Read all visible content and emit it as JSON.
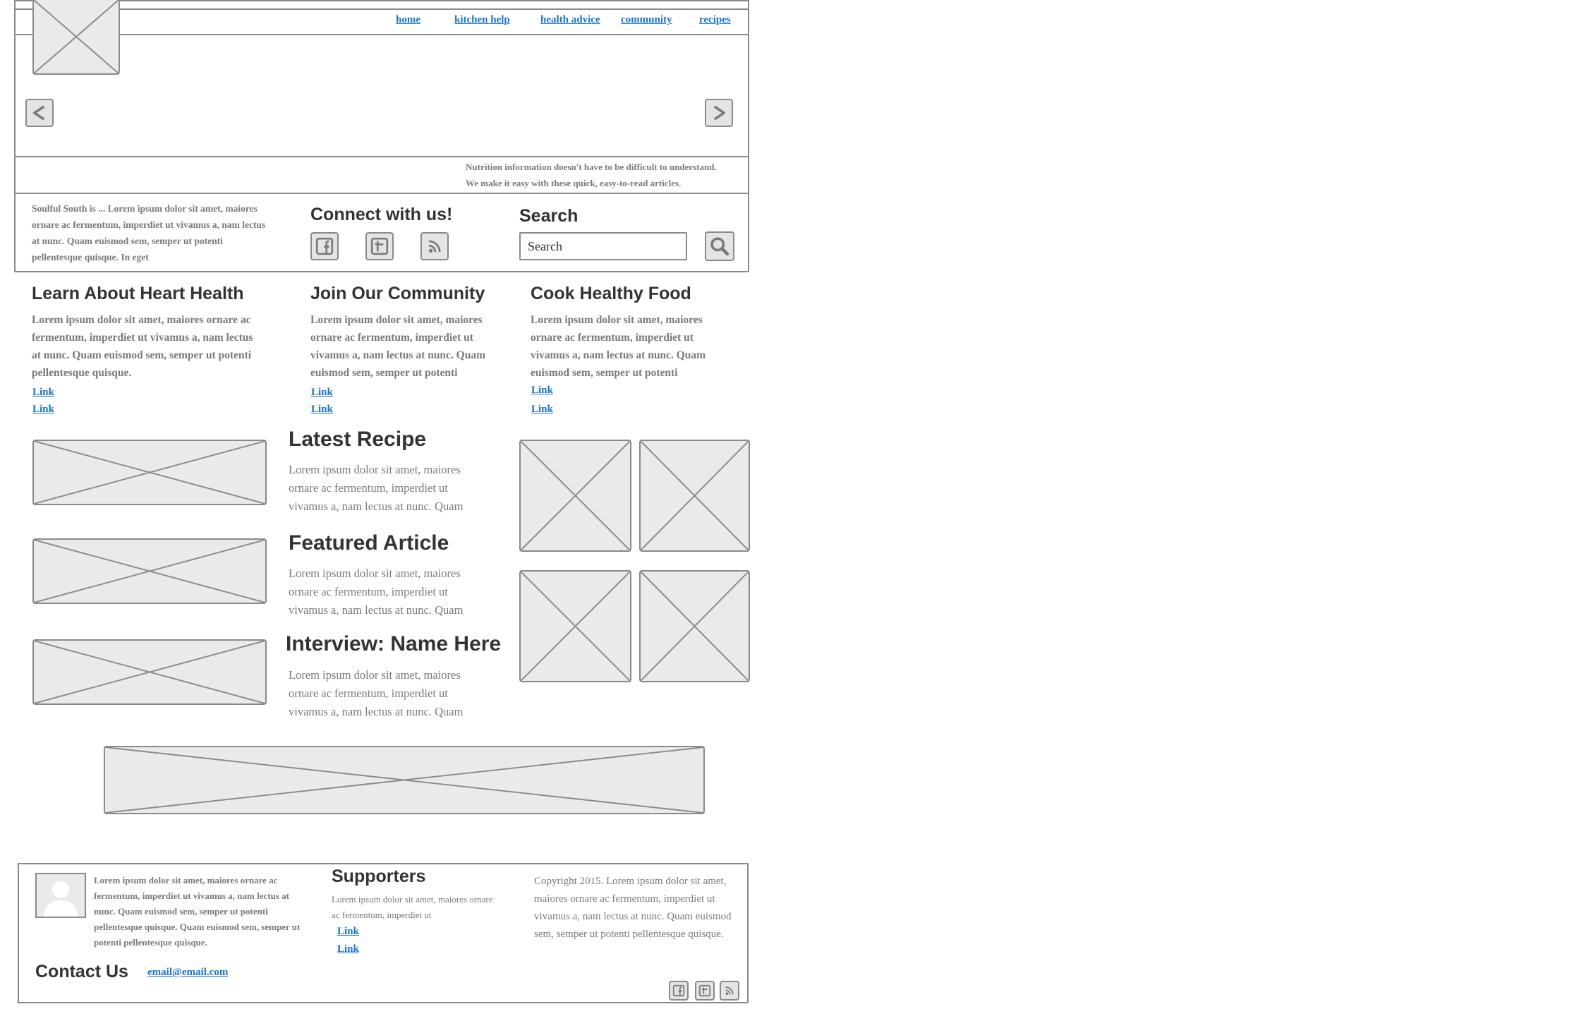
{
  "nav": {
    "items": [
      "home",
      "kitchen help",
      "health advice",
      "community",
      "recipes"
    ]
  },
  "hero": {
    "prev_label": "<",
    "next_label": ">",
    "tagline_1": "Nutrition information doesn't have to be difficult to understand.",
    "tagline_2": "We make it easy with these quick, easy-to-read articles."
  },
  "intro": {
    "text": "Soulful South is ... Lorem ipsum dolor sit amet, maiores ornare ac fermentum, imperdiet ut vivamus a, nam lectus at nunc. Quam euismod sem, semper ut potenti pellentesque quisque. In eget"
  },
  "connect": {
    "title": "Connect with us!",
    "icons": [
      "facebook-icon",
      "twitter-icon",
      "rss-icon"
    ]
  },
  "search": {
    "title": "Search",
    "value": "Search"
  },
  "features": [
    {
      "title": "Learn About Heart Health",
      "text": "Lorem ipsum dolor sit amet, maiores ornare ac fermentum, imperdiet ut vivamus a, nam lectus at nunc. Quam euismod sem, semper ut potenti pellentesque quisque.",
      "links": [
        "Link",
        "Link"
      ]
    },
    {
      "title": "Join Our Community",
      "text": "Lorem ipsum dolor sit amet, maiores ornare ac fermentum, imperdiet ut vivamus a, nam lectus at nunc. Quam euismod sem, semper ut potenti",
      "links": [
        "Link",
        "Link"
      ]
    },
    {
      "title": "Cook Healthy Food",
      "text": "Lorem ipsum dolor sit amet, maiores ornare ac fermentum, imperdiet ut vivamus a, nam lectus at nunc. Quam euismod sem, semper ut potenti",
      "links": [
        "Link",
        "Link"
      ]
    }
  ],
  "articles": [
    {
      "title": "Latest Recipe",
      "text": "Lorem ipsum dolor sit amet, maiores ornare ac fermentum, imperdiet ut vivamus a, nam lectus at nunc. Quam"
    },
    {
      "title": "Featured Article",
      "text": "Lorem ipsum dolor sit amet, maiores ornare ac fermentum, imperdiet ut vivamus a, nam lectus at nunc. Quam"
    },
    {
      "title": "Interview: Name Here",
      "text": "Lorem ipsum dolor sit amet, maiores ornare ac fermentum, imperdiet ut vivamus a, nam lectus at nunc. Quam"
    }
  ],
  "footer": {
    "about_text": "Lorem ipsum dolor sit amet, maiores ornare ac fermentum, imperdiet ut vivamus a, nam lectus at nunc. Quam euismod sem, semper ut potenti pellentesque quisque. Quam euismod sem, semper ut potenti pellentesque quisque.",
    "contact_title": "Contact Us",
    "email": "email@email.com",
    "supporters_title": "Supporters",
    "supporters_text": "Lorem ipsum dolor sit amet, maiores ornare ac fermentum, imperdiet ut",
    "supporters_links": [
      "Link",
      "Link"
    ],
    "copyright": "Copyright 2015. Lorem ipsum dolor sit amet, maiores ornare ac fermentum, imperdiet ut vivamus a, nam lectus at nunc. Quam euismod sem, semper ut potenti pellentesque quisque.",
    "icons": [
      "facebook-icon",
      "twitter-icon",
      "rss-icon"
    ]
  },
  "colors": {
    "link": "#1a73c9",
    "border": "#8a8a8a",
    "placeholder_fill": "#eaeaea",
    "heading": "#333333",
    "body_text": "#7a7a7a"
  }
}
